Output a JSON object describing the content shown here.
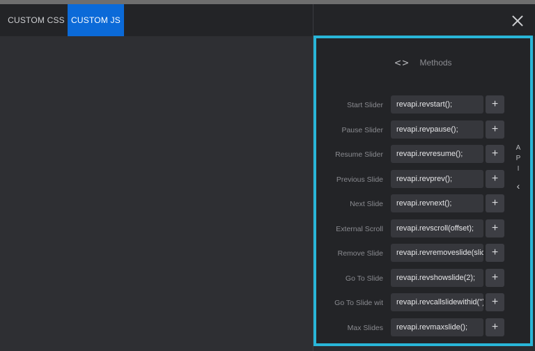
{
  "tabs": [
    {
      "label": "CUSTOM CSS"
    },
    {
      "label": "CUSTOM JS"
    }
  ],
  "methods": {
    "title": "Methods",
    "icon": "code-icon",
    "rows": [
      {
        "label": "Start Slider",
        "value": "revapi.revstart();"
      },
      {
        "label": "Pause Slider",
        "value": "revapi.revpause();"
      },
      {
        "label": "Resume Slider",
        "value": "revapi.revresume();"
      },
      {
        "label": "Previous Slide",
        "value": "revapi.revprev();"
      },
      {
        "label": "Next Slide",
        "value": "revapi.revnext();"
      },
      {
        "label": "External Scroll",
        "value": "revapi.revscroll(offset);"
      },
      {
        "label": "Remove Slide",
        "value": "revapi.revremoveslide(slideindex);"
      },
      {
        "label": "Go To Slide",
        "value": "revapi.revshowslide(2);"
      },
      {
        "label": "Go To Slide wit",
        "value": "revapi.revcallslidewithid('');"
      },
      {
        "label": "Max Slides",
        "value": "revapi.revmaxslide();"
      }
    ],
    "add_symbol": "+"
  },
  "api_tab": {
    "letters": [
      "A",
      "P",
      "I"
    ],
    "chevron": "‹"
  },
  "close_icon": "close-icon",
  "colors": {
    "accent_tab": "#0b6ad8",
    "panel_border": "#29b6d8"
  }
}
